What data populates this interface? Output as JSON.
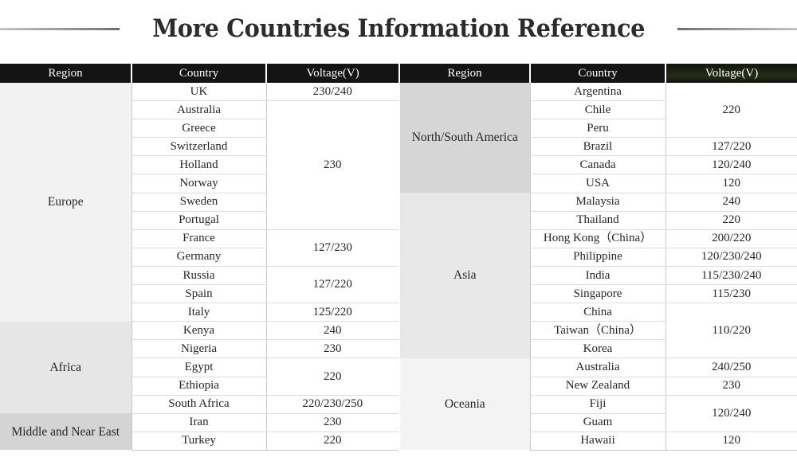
{
  "title": "More Countries Information Reference",
  "colors": {
    "header_bg": "#141414",
    "header_text": "#ffffff",
    "header_accent_olive": "#262e17",
    "cell_text": "#262626",
    "grid_line": "#c9c9c9",
    "row_line": "#dddddd",
    "region_tint_europe": "#f2f2f2",
    "region_tint_africa": "#e6e6e6",
    "region_tint_middle_east": "#d4d4d4",
    "region_tint_americas": "#d6d6d6",
    "region_tint_asia": "#e8e8e8",
    "region_tint_oceania": "#f3f3f3"
  },
  "tables": [
    {
      "id": "left-table",
      "headers": [
        "Region",
        "Country",
        "Voltage(V)"
      ],
      "header_accent": false,
      "regions": [
        {
          "name": "Europe",
          "rows": 13,
          "tint": "tint-a",
          "countries": [
            "UK",
            "Australia",
            "Greece",
            "Switzerland",
            "Holland",
            "Norway",
            "Sweden",
            "Portugal",
            "France",
            "Germany",
            "Russia",
            "Spain",
            "Italy"
          ],
          "voltages": [
            {
              "value": "230/240",
              "rows": 1
            },
            {
              "value": "230",
              "rows": 7
            },
            {
              "value": "127/230",
              "rows": 2
            },
            {
              "value": "127/220",
              "rows": 2
            },
            {
              "value": "125/220",
              "rows": 1
            }
          ]
        },
        {
          "name": "Africa",
          "rows": 5,
          "tint": "tint-b",
          "countries": [
            "Kenya",
            "Nigeria",
            "Egypt",
            "Ethiopia",
            "South Africa"
          ],
          "voltages": [
            {
              "value": "240",
              "rows": 1
            },
            {
              "value": "230",
              "rows": 1
            },
            {
              "value": "220",
              "rows": 2
            },
            {
              "value": "220/230/250",
              "rows": 1
            }
          ]
        },
        {
          "name": "Middle and Near East",
          "rows": 2,
          "tint": "tint-c",
          "countries": [
            "Iran",
            "Turkey"
          ],
          "voltages": [
            {
              "value": "230",
              "rows": 1
            },
            {
              "value": "220",
              "rows": 1
            }
          ]
        }
      ]
    },
    {
      "id": "right-table",
      "headers": [
        "Region",
        "Country",
        "Voltage(V)"
      ],
      "header_accent": true,
      "regions": [
        {
          "name": "North/South America",
          "rows": 6,
          "tint": "tint-d",
          "countries": [
            "Argentina",
            "Chile",
            "Peru",
            "Brazil",
            "Canada",
            "USA"
          ],
          "voltages": [
            {
              "value": "220",
              "rows": 3
            },
            {
              "value": "127/220",
              "rows": 1
            },
            {
              "value": "120/240",
              "rows": 1
            },
            {
              "value": "120",
              "rows": 1
            }
          ]
        },
        {
          "name": "Asia",
          "rows": 9,
          "tint": "tint-e",
          "countries": [
            "Malaysia",
            "Thailand",
            "Hong Kong（China）",
            "Philippine",
            "India",
            "Singapore",
            "China",
            "Taiwan（China）",
            "Korea"
          ],
          "voltages": [
            {
              "value": "240",
              "rows": 1
            },
            {
              "value": "220",
              "rows": 1
            },
            {
              "value": "200/220",
              "rows": 1
            },
            {
              "value": "120/230/240",
              "rows": 1
            },
            {
              "value": "115/230/240",
              "rows": 1
            },
            {
              "value": "115/230",
              "rows": 1
            },
            {
              "value": "110/220",
              "rows": 3
            }
          ]
        },
        {
          "name": "Oceania",
          "rows": 5,
          "tint": "tint-f",
          "countries": [
            "Australia",
            "New Zealand",
            "Fiji",
            "Guam",
            "Hawaii"
          ],
          "voltages": [
            {
              "value": "240/250",
              "rows": 1
            },
            {
              "value": "230",
              "rows": 1
            },
            {
              "value": "120/240",
              "rows": 2
            },
            {
              "value": "120",
              "rows": 1
            }
          ]
        }
      ]
    }
  ]
}
